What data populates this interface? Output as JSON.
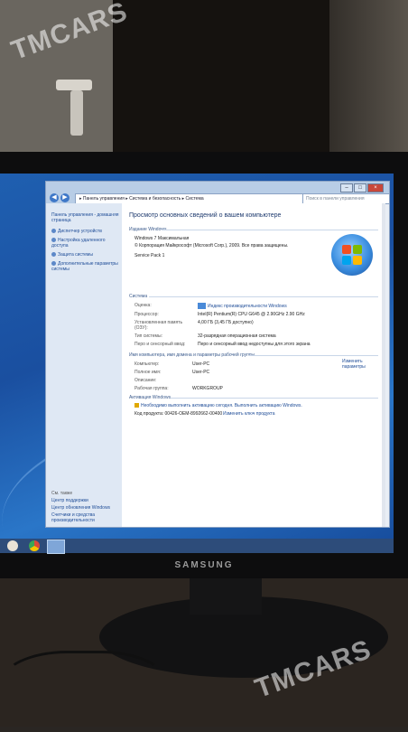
{
  "watermark": {
    "text_top": "TMCARS",
    "text_bottom": "TMCARS"
  },
  "monitor": {
    "brand": "SAMSUNG"
  },
  "window": {
    "address": "▸ Панель управления ▸ Система и безопасность ▸ Система",
    "search_placeholder": "Поиск в панели управления",
    "sidebar": {
      "home": "Панель управления - домашняя страница",
      "items": [
        "Диспетчер устройств",
        "Настройка удаленного доступа",
        "Защита системы",
        "Дополнительные параметры системы"
      ],
      "see_also_title": "См. также",
      "see_also": [
        "Центр поддержки",
        "Центр обновления Windows",
        "Счетчики и средства производительности"
      ]
    },
    "main": {
      "title": "Просмотр основных сведений о вашем компьютере",
      "edition_header": "Издание Windows",
      "edition": "Windows 7 Максимальная",
      "copyright": "© Корпорация Майкрософт (Microsoft Corp.), 2009. Все права защищены.",
      "service_pack": "Service Pack 1",
      "system_header": "Система",
      "rows": [
        {
          "label": "Оценка:",
          "value": "Индекс производительности Windows"
        },
        {
          "label": "Процессор:",
          "value": "Intel(R) Pentium(R) CPU G645 @ 2.90GHz   2.90 GHz"
        },
        {
          "label": "Установленная память (ОЗУ):",
          "value": "4,00 ГБ (3,45 ГБ доступно)"
        },
        {
          "label": "Тип системы:",
          "value": "32-разрядная операционная система"
        },
        {
          "label": "Перо и сенсорный ввод:",
          "value": "Перо и сенсорный ввод недоступны для этого экрана"
        }
      ],
      "computer_header": "Имя компьютера, имя домена и параметры рабочей группы",
      "computer_rows": [
        {
          "label": "Компьютер:",
          "value": "User-PC"
        },
        {
          "label": "Полное имя:",
          "value": "User-PC"
        },
        {
          "label": "Описание:",
          "value": ""
        },
        {
          "label": "Рабочая группа:",
          "value": "WORKGROUP"
        }
      ],
      "change_params": "Изменить параметры",
      "activation_header": "Активация Windows",
      "activation_notice": "Необходимо выполнить активацию сегодня. Выполнить активацию Windows.",
      "product_code_label": "Код продукта: 00426-OEM-8992662-00400",
      "change_key": "Изменить ключ продукта"
    }
  },
  "colors": {
    "accent": "#1e4c97",
    "desktop": "#1f5fb0"
  }
}
